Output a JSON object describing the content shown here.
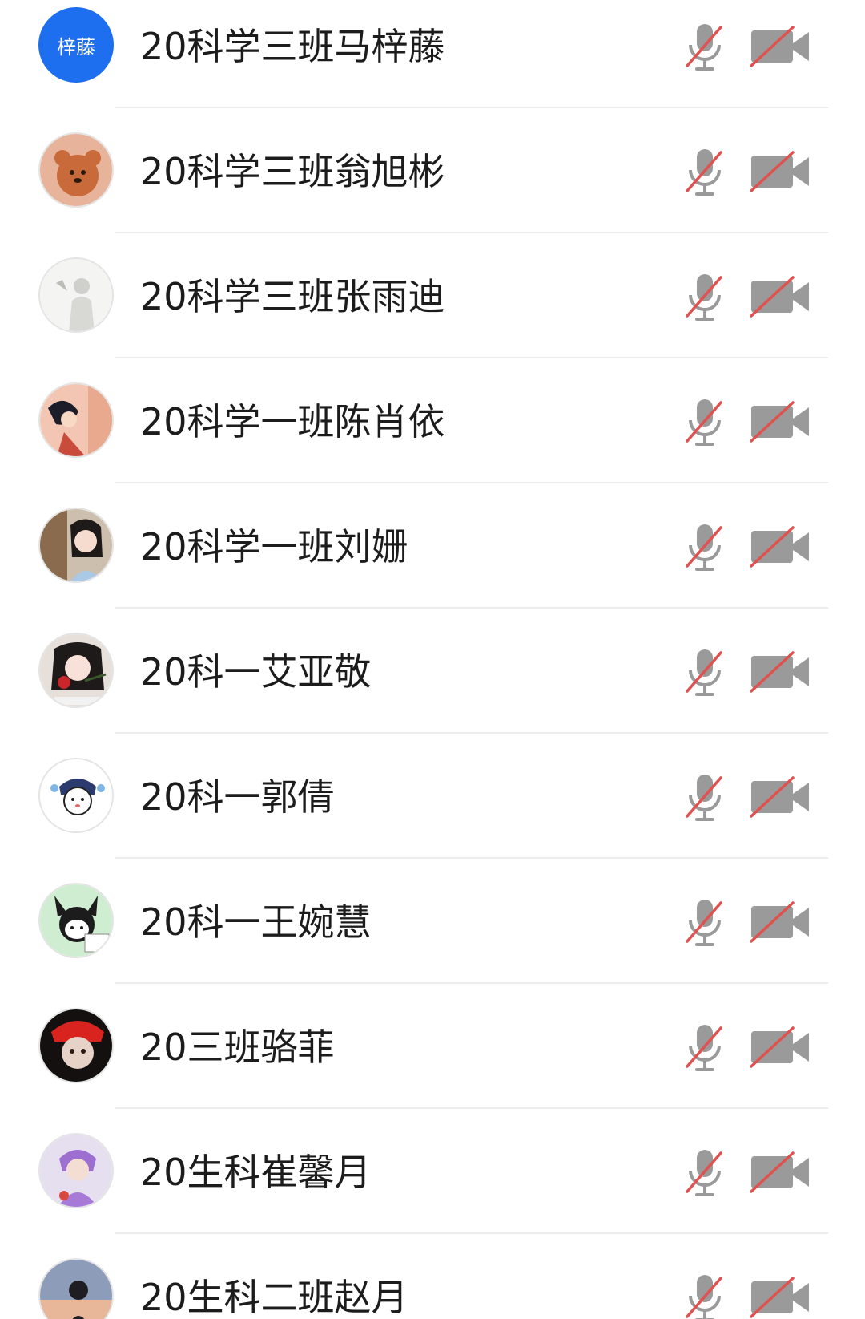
{
  "participants": [
    {
      "name": "20科学三班马梓藤",
      "avatar_text": "梓藤",
      "avatar_color": "#1e6ff0",
      "mic": "mic-off-icon",
      "camera": "camera-off-icon"
    },
    {
      "name": "20科学三班翁旭彬",
      "mic": "mic-off-icon",
      "camera": "camera-off-icon"
    },
    {
      "name": "20科学三班张雨迪",
      "mic": "mic-off-icon",
      "camera": "camera-off-icon"
    },
    {
      "name": "20科学一班陈肖依",
      "mic": "mic-off-icon",
      "camera": "camera-off-icon"
    },
    {
      "name": "20科学一班刘姗",
      "mic": "mic-off-icon",
      "camera": "camera-off-icon"
    },
    {
      "name": "20科一艾亚敬",
      "mic": "mic-off-icon",
      "camera": "camera-off-icon"
    },
    {
      "name": "20科一郭倩",
      "mic": "mic-off-icon",
      "camera": "camera-off-icon"
    },
    {
      "name": "20科一王婉慧",
      "mic": "mic-off-icon",
      "camera": "camera-off-icon"
    },
    {
      "name": "20三班骆菲",
      "mic": "mic-off-icon",
      "camera": "camera-off-icon"
    },
    {
      "name": "20生科崔馨月",
      "mic": "mic-off-icon",
      "camera": "camera-off-icon"
    },
    {
      "name": "20生科二班赵月",
      "mic": "mic-off-icon",
      "camera": "camera-off-icon"
    }
  ],
  "colors": {
    "icon_gray": "#9a9a9a",
    "slash_red": "#e0524f",
    "divider": "#ececec"
  }
}
